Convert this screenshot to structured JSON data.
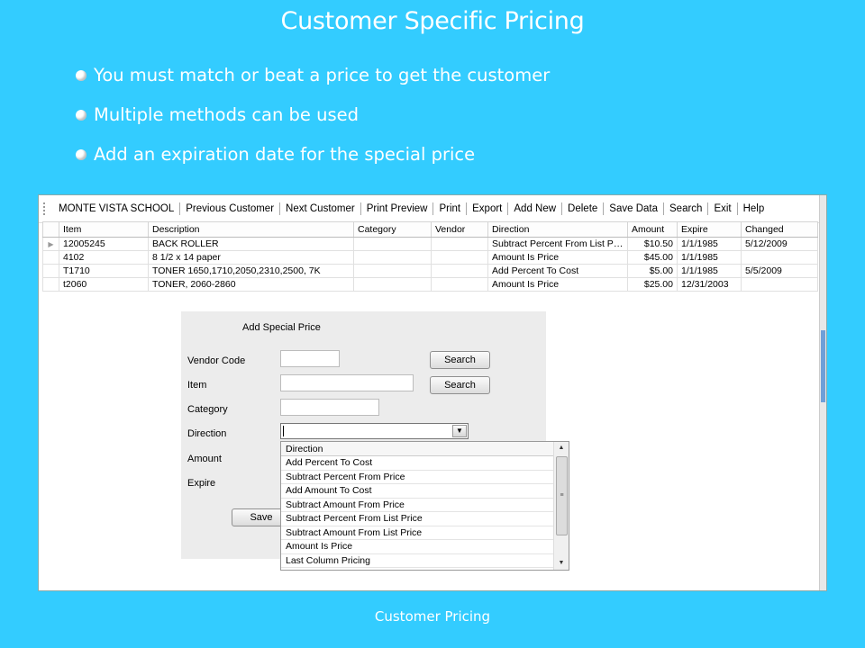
{
  "slide": {
    "title": "Customer Specific Pricing",
    "bullets": [
      "You must match or beat a price to get the customer",
      "Multiple methods can be used",
      "Add an expiration date for the special price"
    ],
    "footer": "Customer Pricing"
  },
  "toolbar": {
    "items": [
      "MONTE VISTA SCHOOL",
      "Previous Customer",
      "Next Customer",
      "Print Preview",
      "Print",
      "Export",
      "Add New",
      "Delete",
      "Save Data",
      "Search",
      "Exit",
      "Help"
    ]
  },
  "grid": {
    "headers": [
      "Item",
      "Description",
      "Category",
      "Vendor",
      "Direction",
      "Amount",
      "Expire",
      "Changed"
    ],
    "rows": [
      [
        "12005245",
        "BACK ROLLER",
        "",
        "",
        "Subtract Percent From List Pri...",
        "$10.50",
        "1/1/1985",
        "5/12/2009"
      ],
      [
        "4102",
        "8 1/2 x 14 paper",
        "",
        "",
        "Amount Is Price",
        "$45.00",
        "1/1/1985",
        ""
      ],
      [
        "T1710",
        "TONER 1650,1710,2050,2310,2500, 7K",
        "",
        "",
        "Add Percent To Cost",
        "$5.00",
        "1/1/1985",
        "5/5/2009"
      ],
      [
        "t2060",
        "TONER, 2060-2860",
        "",
        "",
        "Amount Is Price",
        "$25.00",
        "12/31/2003",
        ""
      ]
    ]
  },
  "dialog": {
    "title": "Add Special Price",
    "vendor_code_label": "Vendor Code",
    "item_label": "Item",
    "category_label": "Category",
    "direction_label": "Direction",
    "amount_label": "Amount",
    "expire_label": "Expire",
    "search_label": "Search",
    "save_label": "Save",
    "direction_value": ""
  },
  "direction_list": {
    "header": "Direction",
    "options": [
      "Add Percent To Cost",
      "Subtract Percent From Price",
      "Add Amount To Cost",
      "Subtract Amount From Price",
      "Subtract Percent From List Price",
      "Subtract Amount From List Price",
      "Amount Is Price",
      "Last Column Pricing"
    ]
  },
  "colors": {
    "slide_background": "#33ccff",
    "scroll_thumb": "#6e9fd8"
  },
  "icons": {
    "bullet": "bullet-dot-icon",
    "row_pointer": "row-pointer-icon",
    "dropdown": "chevron-down-icon",
    "scroll_up": "arrow-up-icon",
    "scroll_down": "arrow-down-icon",
    "scroll_grip": "grip-icon"
  }
}
